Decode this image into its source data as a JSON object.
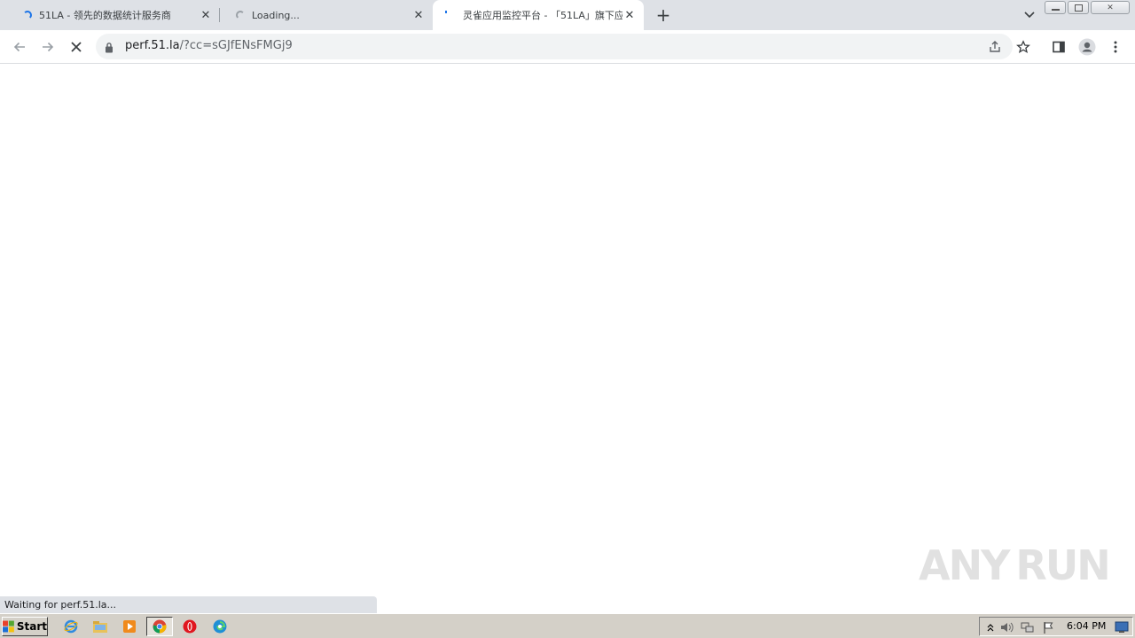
{
  "browser": {
    "tabs": [
      {
        "title": "51LA - 领先的数据统计服务商",
        "loading": true,
        "active": false
      },
      {
        "title": "Loading...",
        "loading": true,
        "active": false
      },
      {
        "title": "灵雀应用监控平台 - 「51LA」旗下应",
        "loading": true,
        "active": true
      }
    ],
    "new_tab_label": "+",
    "address_bar": {
      "host": "perf.51.la",
      "path": "/?cc=sGJfENsFMGj9"
    }
  },
  "status_bubble": "Waiting for perf.51.la...",
  "watermark": {
    "left": "ANY",
    "right": "RUN"
  },
  "taskbar": {
    "start_label": "Start",
    "clock": "6:04 PM",
    "apps": [
      "internet-explorer-icon",
      "file-explorer-icon",
      "media-player-icon",
      "chrome-icon",
      "opera-icon",
      "edge-icon"
    ]
  },
  "colors": {
    "tabstrip": "#dee1e6",
    "accent": "#1a73e8",
    "taskbar": "#d4d0c8"
  }
}
